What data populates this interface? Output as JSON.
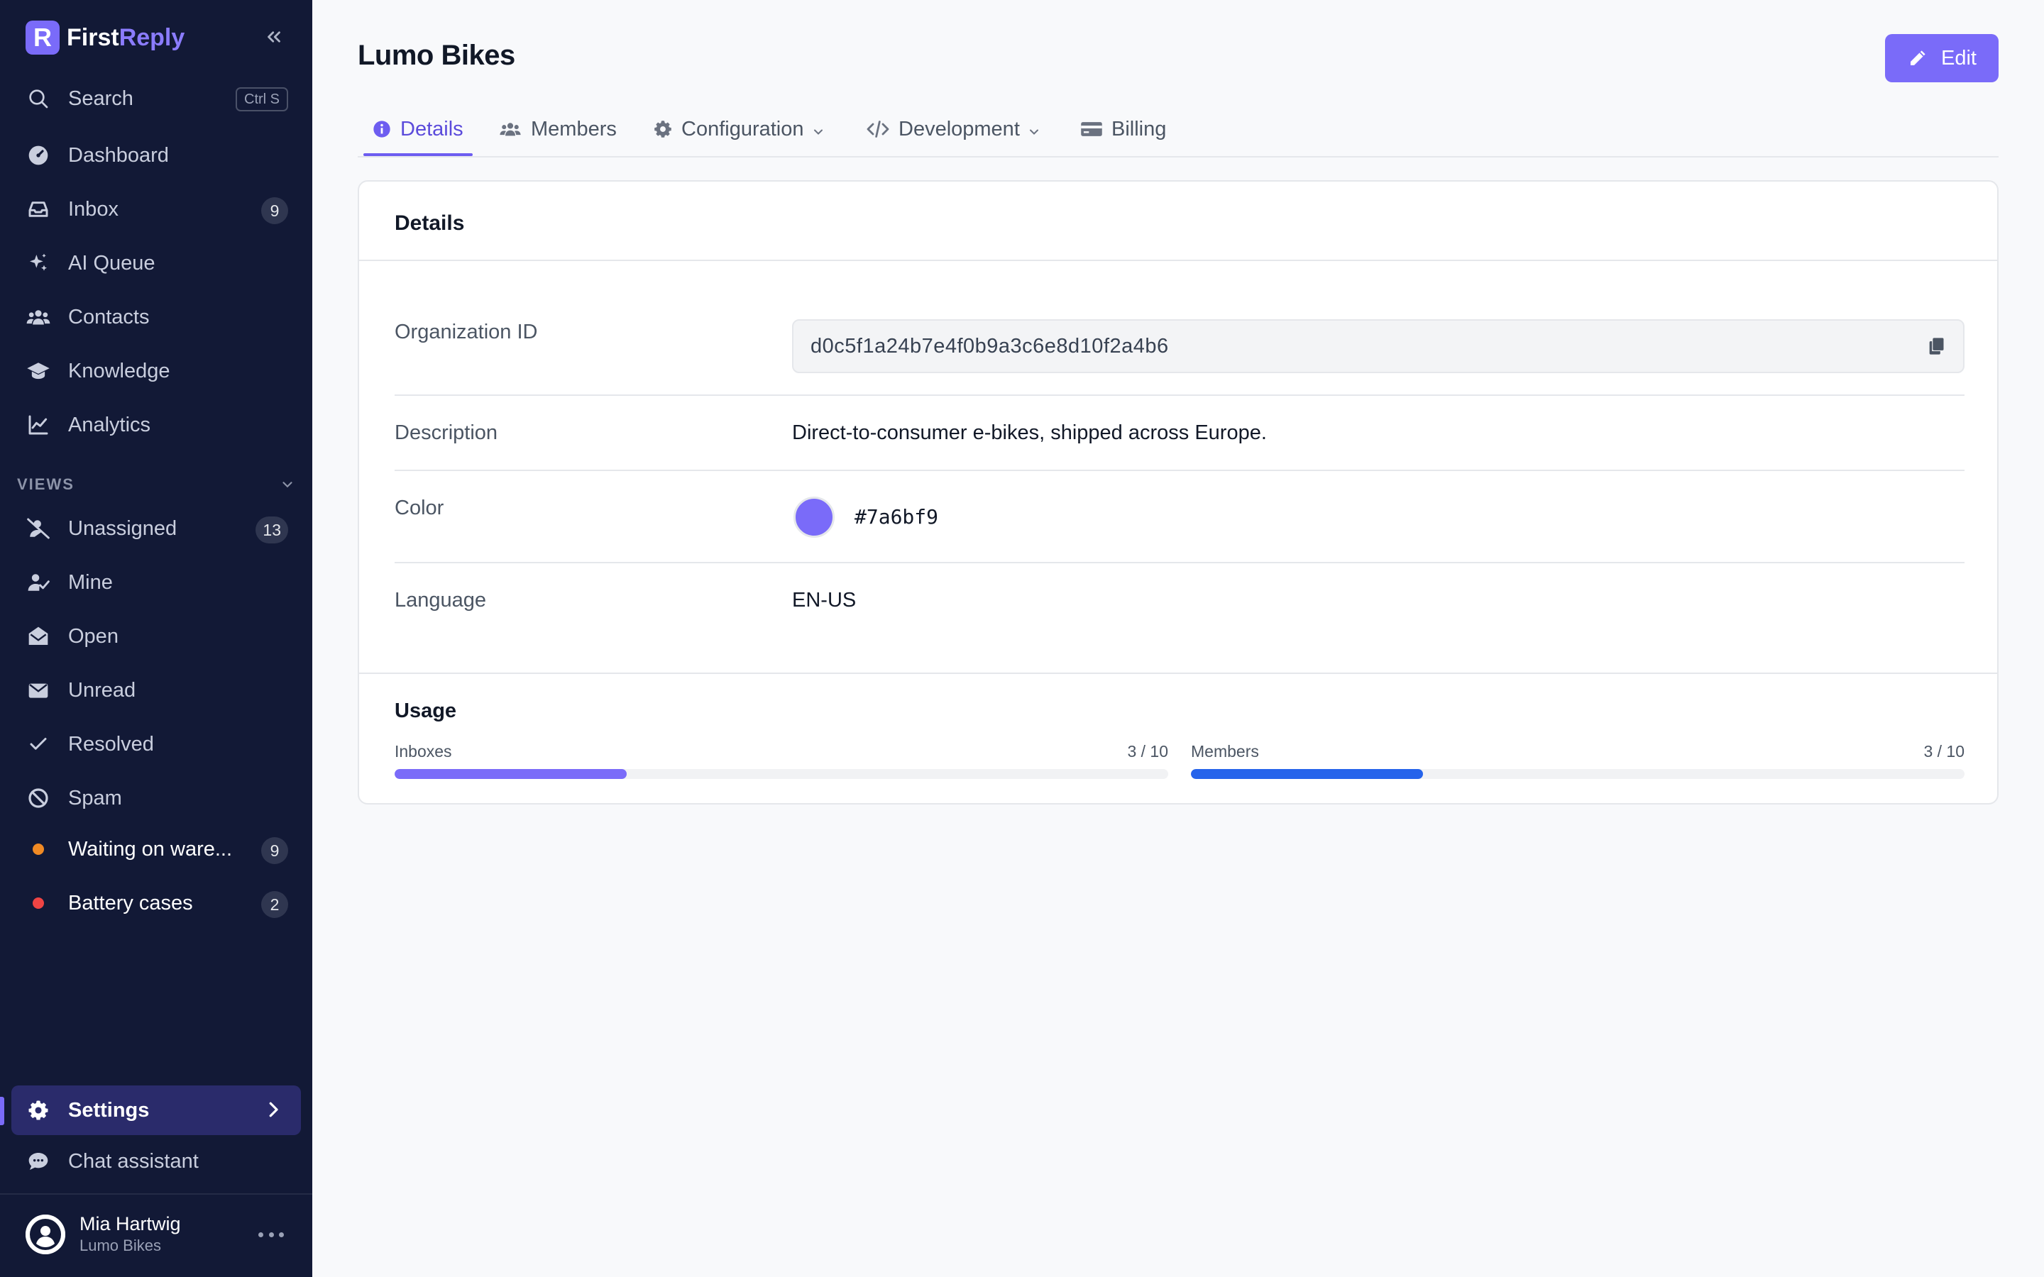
{
  "brand": {
    "first": "First",
    "second": "Reply",
    "logo_letter": "R",
    "accent": "#7a6bf9"
  },
  "search": {
    "label": "Search",
    "shortcut": "Ctrl S"
  },
  "nav": [
    {
      "label": "Dashboard",
      "icon": "dashboard-icon"
    },
    {
      "label": "Inbox",
      "icon": "inbox-icon",
      "badge": "9"
    },
    {
      "label": "AI Queue",
      "icon": "sparkles-icon"
    },
    {
      "label": "Contacts",
      "icon": "contacts-icon"
    },
    {
      "label": "Knowledge",
      "icon": "graduation-cap-icon"
    },
    {
      "label": "Analytics",
      "icon": "chart-line-icon"
    }
  ],
  "views": {
    "heading": "VIEWS",
    "items": [
      {
        "label": "Unassigned",
        "icon": "user-slash-icon",
        "badge": "13"
      },
      {
        "label": "Mine",
        "icon": "user-check-icon"
      },
      {
        "label": "Open",
        "icon": "envelope-open-icon"
      },
      {
        "label": "Unread",
        "icon": "envelope-icon"
      },
      {
        "label": "Resolved",
        "icon": "check-icon"
      },
      {
        "label": "Spam",
        "icon": "ban-icon"
      },
      {
        "label": "Waiting on ware...",
        "dot_color": "#f08a24",
        "badge": "9"
      },
      {
        "label": "Battery cases",
        "dot_color": "#ef4444",
        "badge": "2"
      }
    ]
  },
  "footer_nav": {
    "settings": "Settings",
    "chat": "Chat assistant"
  },
  "user": {
    "name": "Mia Hartwig",
    "org": "Lumo Bikes"
  },
  "page": {
    "title": "Lumo Bikes",
    "edit_label": "Edit"
  },
  "tabs": [
    {
      "label": "Details",
      "icon": "info-circle-icon",
      "active": true
    },
    {
      "label": "Members",
      "icon": "users-icon"
    },
    {
      "label": "Configuration",
      "icon": "gear-icon",
      "dropdown": true
    },
    {
      "label": "Development",
      "icon": "code-icon",
      "dropdown": true
    },
    {
      "label": "Billing",
      "icon": "credit-card-icon"
    }
  ],
  "details": {
    "heading": "Details",
    "org_id_label": "Organization ID",
    "org_id": "d0c5f1a24b7e4f0b9a3c6e8d10f2a4b6",
    "description_label": "Description",
    "description": "Direct-to-consumer e-bikes, shipped across Europe.",
    "color_label": "Color",
    "color": "#7a6bf9",
    "color_hex": "#7a6bf9",
    "language_label": "Language",
    "language": "EN-US"
  },
  "usage": {
    "heading": "Usage",
    "meters": [
      {
        "label": "Inboxes",
        "count": "3 / 10",
        "used": 3,
        "limit": 10,
        "color": "#7a6bf9"
      },
      {
        "label": "Members",
        "count": "3 / 10",
        "used": 3,
        "limit": 10,
        "color": "#2563eb"
      }
    ]
  }
}
